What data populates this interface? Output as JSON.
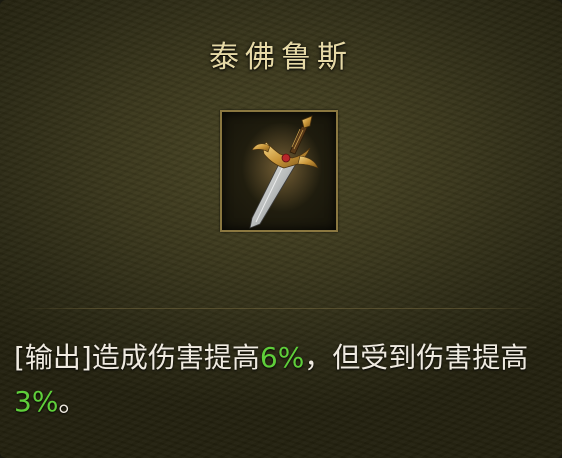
{
  "item": {
    "name": "泰佛鲁斯",
    "icon": "sword-icon"
  },
  "description": {
    "tag": "[输出]",
    "part1": "造成伤害提高",
    "value1": "6%",
    "part2": "，但受到伤害提高",
    "value2": "3%",
    "part3": "。"
  },
  "colors": {
    "title": "#e6d9a6",
    "text": "#efeae0",
    "highlight": "#5fcf3a",
    "frame_border": "#8a7740"
  }
}
